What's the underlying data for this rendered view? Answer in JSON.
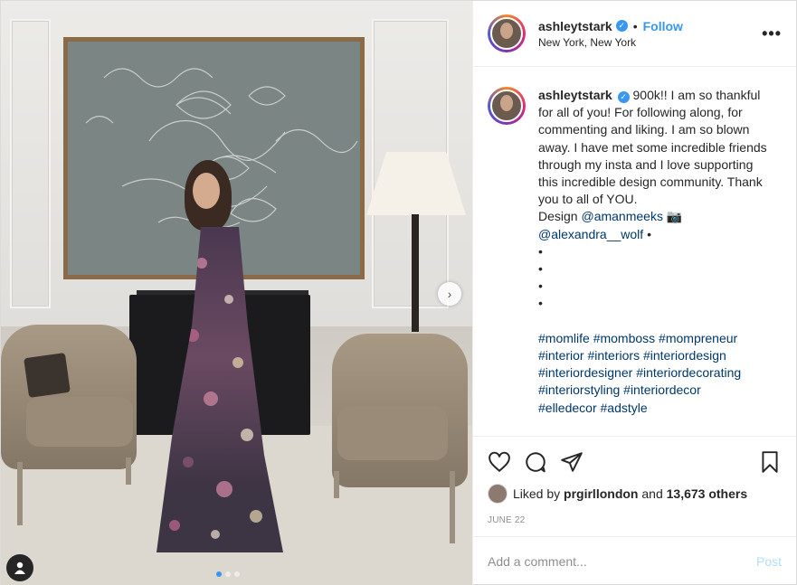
{
  "header": {
    "username": "ashleytstark",
    "separator": "•",
    "follow_label": "Follow",
    "location": "New York, New York",
    "more_label": "•••"
  },
  "caption": {
    "username": "ashleytstark",
    "lines": {
      "l1": "900k!! I am so thankful for all of you! For following along, for commenting and liking. I am so blown away. I have met some incredible friends through my insta and I love supporting this incredible design community. Thank you to all of YOU.",
      "design_prefix": "Design",
      "mention1": "@amanmeeks",
      "camera_emoji": "📷",
      "mention2": "@alexandra__wolf",
      "bullet": "•"
    },
    "dots": [
      "•",
      "•",
      "•",
      "•"
    ],
    "hashtags": [
      "#momlife",
      "#momboss",
      "#mompreneur",
      "#interior",
      "#interiors",
      "#interiordesign",
      "#interiordesigner",
      "#interiordecorating",
      "#interiorstyling",
      "#interiordecor",
      "#elledecor",
      "#adstyle"
    ]
  },
  "likes": {
    "prefix": "Liked by",
    "liker": "prgirllondon",
    "connector": "and",
    "others": "13,673 others"
  },
  "date": "JUNE 22",
  "comment": {
    "placeholder": "Add a comment...",
    "post_label": "Post"
  },
  "media": {
    "carousel_index": 1,
    "carousel_count": 3,
    "next_label": "›"
  },
  "colors": {
    "accent": "#3897f0",
    "link": "#00376b",
    "muted": "#8e8e8e",
    "post_disabled": "#b2dffc"
  }
}
